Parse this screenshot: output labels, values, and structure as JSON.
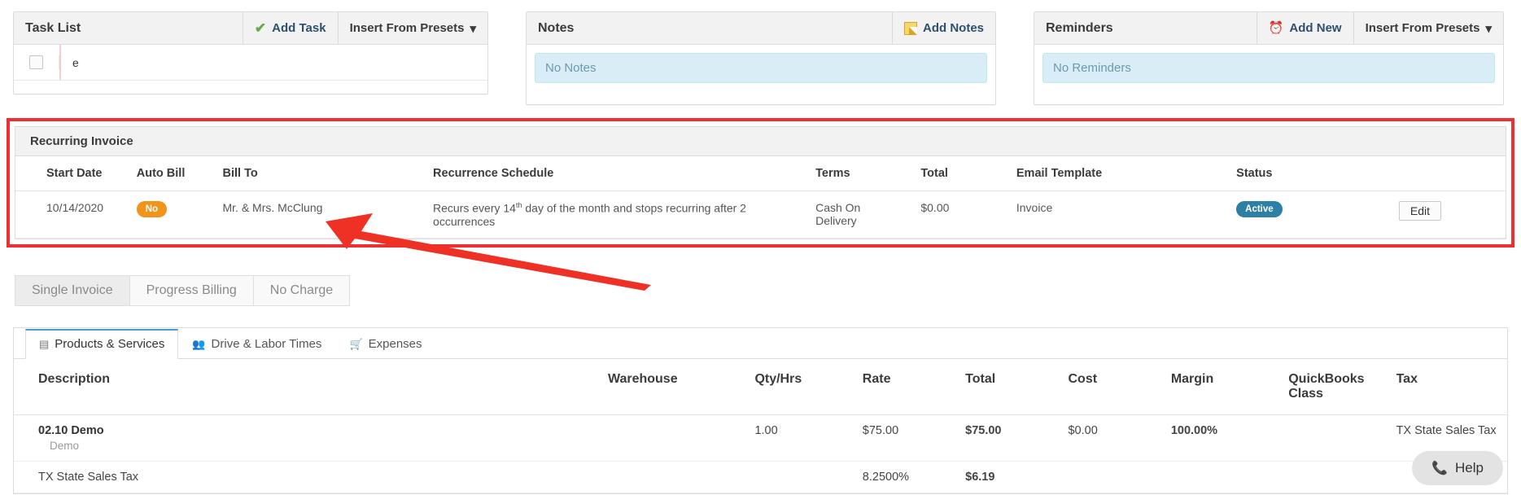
{
  "panels": {
    "task_list": {
      "title": "Task List",
      "add_label": "Add Task",
      "presets_label": "Insert From Presets",
      "caret": "▾",
      "row_text": "e"
    },
    "notes": {
      "title": "Notes",
      "add_label": "Add Notes",
      "empty_text": "No Notes"
    },
    "reminders": {
      "title": "Reminders",
      "add_label": "Add New",
      "presets_label": "Insert From Presets",
      "caret": "▾",
      "empty_text": "No Reminders"
    }
  },
  "recurring_invoice": {
    "title": "Recurring Invoice",
    "headers": {
      "start_date": "Start Date",
      "auto_bill": "Auto Bill",
      "bill_to": "Bill To",
      "recurrence_schedule": "Recurrence Schedule",
      "terms": "Terms",
      "total": "Total",
      "email_template": "Email Template",
      "status": "Status"
    },
    "row": {
      "start_date": "10/14/2020",
      "auto_bill": "No",
      "bill_to": "Mr. & Mrs. McClung",
      "schedule_pre": "Recurs every 14",
      "schedule_sup": "th",
      "schedule_post": " day of the month and stops recurring after 2 occurrences",
      "terms": "Cash On Delivery",
      "total": "$0.00",
      "email_template": "Invoice",
      "status": "Active",
      "edit_label": "Edit"
    },
    "highlight_color": "#ee2f2f",
    "badge_no_color": "#f0941c",
    "badge_active_color": "#2d7fa5"
  },
  "billing_types": [
    {
      "label": "Single Invoice",
      "active": true
    },
    {
      "label": "Progress Billing",
      "active": false
    },
    {
      "label": "No Charge",
      "active": false
    }
  ],
  "tabs": [
    {
      "label": "Products & Services",
      "icon": "clipboard-icon",
      "glyph": "▤",
      "active": true
    },
    {
      "label": "Drive & Labor Times",
      "icon": "people-icon",
      "glyph": "👥",
      "active": false
    },
    {
      "label": "Expenses",
      "icon": "cart-icon",
      "glyph": "🛒",
      "active": false
    }
  ],
  "items_table": {
    "headers": {
      "description": "Description",
      "warehouse": "Warehouse",
      "qty_hrs": "Qty/Hrs",
      "rate": "Rate",
      "total": "Total",
      "cost": "Cost",
      "margin": "Margin",
      "quickbooks_class": "QuickBooks Class",
      "tax": "Tax"
    },
    "rows": [
      {
        "description": "02.10 Demo",
        "description_sub": "Demo",
        "warehouse": "",
        "qty_hrs": "1.00",
        "rate": "$75.00",
        "total": "$75.00",
        "cost": "$0.00",
        "margin": "100.00%",
        "quickbooks_class": "",
        "tax": "TX State Sales Tax"
      },
      {
        "description": "TX State Sales Tax",
        "description_sub": "",
        "warehouse": "",
        "qty_hrs": "",
        "rate": "8.2500%",
        "total": "$6.19",
        "cost": "",
        "margin": "",
        "quickbooks_class": "",
        "tax": ""
      }
    ]
  },
  "help": {
    "label": "Help",
    "icon": "phone-icon"
  }
}
